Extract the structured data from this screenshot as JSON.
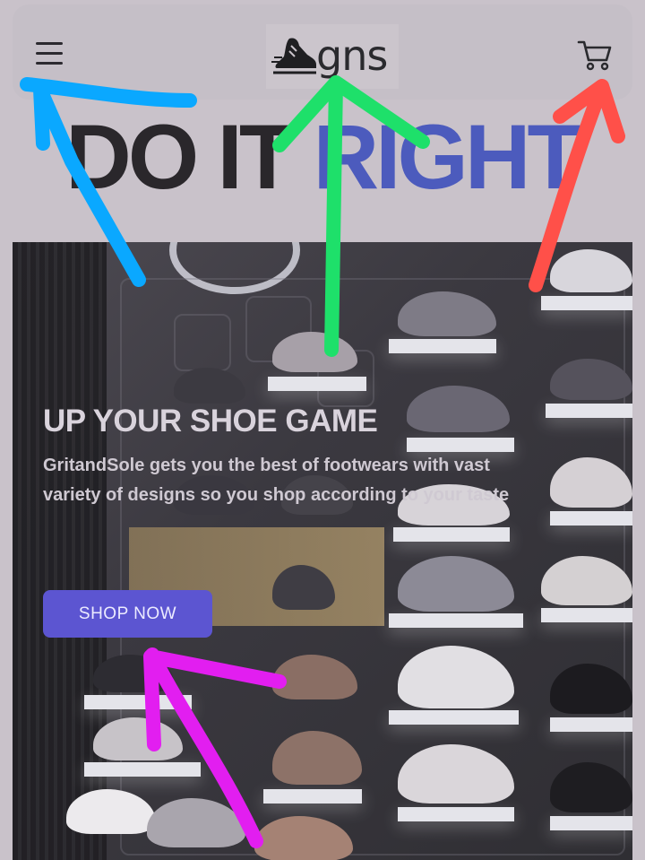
{
  "navbar": {
    "menu_icon": "hamburger-menu-icon",
    "logo_text": "gns",
    "logo_icon": "running-shoe-icon",
    "cart_icon": "shopping-cart-icon"
  },
  "headline": {
    "part1": "DO IT ",
    "part2": "RIGHT"
  },
  "hero": {
    "title": "UP YOUR SHOE GAME",
    "description": "GritandSole gets you the best of footwears with vast variety of designs so you shop according to your taste",
    "cta_label": "SHOP NOW",
    "background_image": "sneaker-store-wall-photo"
  },
  "colors": {
    "accent_blue": "#4c5bbd",
    "button_purple": "#5c55d1",
    "annotation_blue": "#0aa8ff",
    "annotation_green": "#1ee06a",
    "annotation_red": "#ff5049",
    "annotation_magenta": "#e21ef0"
  }
}
